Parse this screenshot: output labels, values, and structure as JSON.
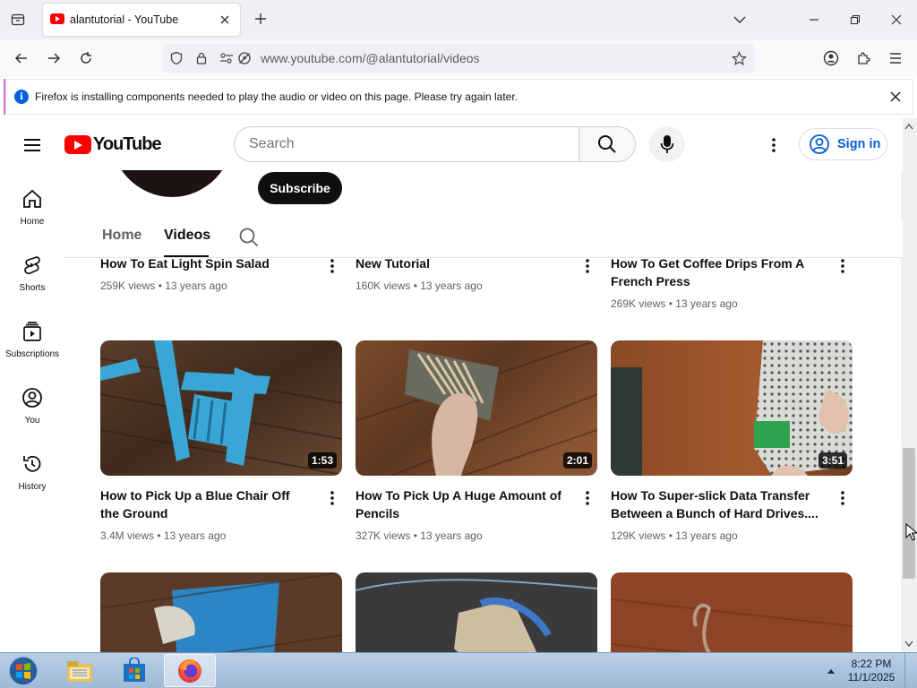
{
  "browser": {
    "tab_title": "alantutorial - YouTube",
    "url_host": "www.youtube.com",
    "url_path": "/@alantutorial/videos"
  },
  "notification": {
    "message": "Firefox is installing components needed to play the audio or video on this page. Please try again later."
  },
  "youtube": {
    "logo_text": "YouTube",
    "search_placeholder": "Search",
    "sign_in_label": "Sign in",
    "subscribe_label": "Subscribe",
    "guide": [
      {
        "label": "Home",
        "icon": "home-icon"
      },
      {
        "label": "Shorts",
        "icon": "shorts-icon"
      },
      {
        "label": "Subscriptions",
        "icon": "subscriptions-icon"
      },
      {
        "label": "You",
        "icon": "you-icon"
      },
      {
        "label": "History",
        "icon": "history-icon"
      }
    ],
    "channel_tabs": {
      "home": "Home",
      "videos": "Videos",
      "selected": "Videos"
    },
    "videos": [
      {
        "title": "How To Eat Light Spin Salad",
        "meta": "259K views • 13 years ago"
      },
      {
        "title": "New Tutorial",
        "meta": "160K views • 13 years ago"
      },
      {
        "title": "How To Get Coffee Drips From A French Press",
        "meta": "269K views • 13 years ago"
      },
      {
        "title": "How to Pick Up a Blue Chair Off the Ground",
        "meta": "3.4M views • 13 years ago",
        "duration": "1:53"
      },
      {
        "title": "How To Pick Up A Huge Amount of Pencils",
        "meta": "327K views • 13 years ago",
        "duration": "2:01"
      },
      {
        "title": "How To Super-slick Data Transfer Between a Bunch of Hard Drives....",
        "meta": "129K views • 13 years ago",
        "duration": "3:51"
      }
    ]
  },
  "taskbar": {
    "time": "8:22 PM",
    "date": "11/1/2025"
  },
  "colors": {
    "youtube_red": "#ff0000",
    "sign_in_blue": "#065fd4",
    "notification_info_blue": "#0060df"
  }
}
